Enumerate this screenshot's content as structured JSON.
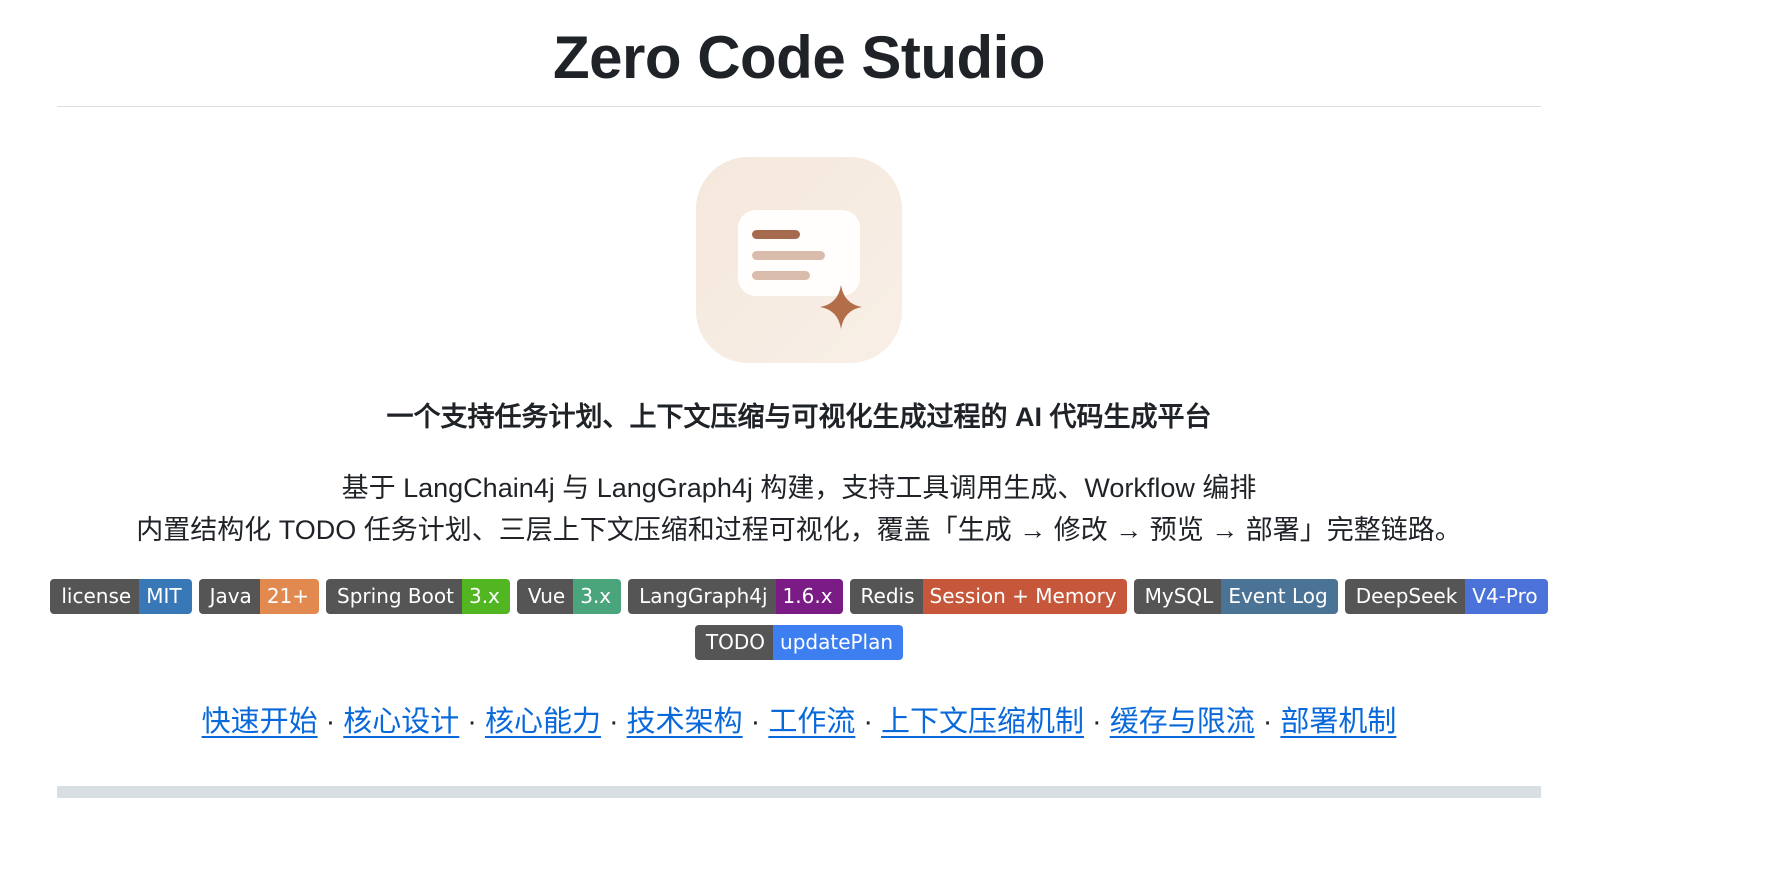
{
  "readme": {
    "title": "Zero Code Studio",
    "logo_icon": "chat-card-sparkle-icon",
    "tagline": "一个支持任务计划、上下文压缩与可视化生成过程的 AI 代码生成平台",
    "description": [
      "基于 LangChain4j 与 LangGraph4j 构建，支持工具调用生成、Workflow 编排",
      "内置结构化 TODO 任务计划、三层上下文压缩和过程可视化，覆盖「生成 → 修改 → 预览 → 部署」完整链路。"
    ],
    "badges": [
      {
        "label": "license",
        "value": "MIT",
        "color": "#3978b7"
      },
      {
        "label": "Java",
        "value": "21+",
        "color": "#e2894f"
      },
      {
        "label": "Spring Boot",
        "value": "3.x",
        "color": "#52b522"
      },
      {
        "label": "Vue",
        "value": "3.x",
        "color": "#4aa57d"
      },
      {
        "label": "LangGraph4j",
        "value": "1.6.x",
        "color": "#7b1c86"
      },
      {
        "label": "Redis",
        "value": "Session + Memory",
        "color": "#c6573b"
      },
      {
        "label": "MySQL",
        "value": "Event Log",
        "color": "#4a7395"
      },
      {
        "label": "DeepSeek",
        "value": "V4-Pro",
        "color": "#4a72d8"
      },
      {
        "label": "TODO",
        "value": "updatePlan",
        "color": "#3d7ff0"
      }
    ],
    "nav_links": [
      "快速开始",
      "核心设计",
      "核心能力",
      "技术架构",
      "工作流",
      "上下文压缩机制",
      "缓存与限流",
      "部署机制"
    ],
    "nav_separator": "·"
  }
}
